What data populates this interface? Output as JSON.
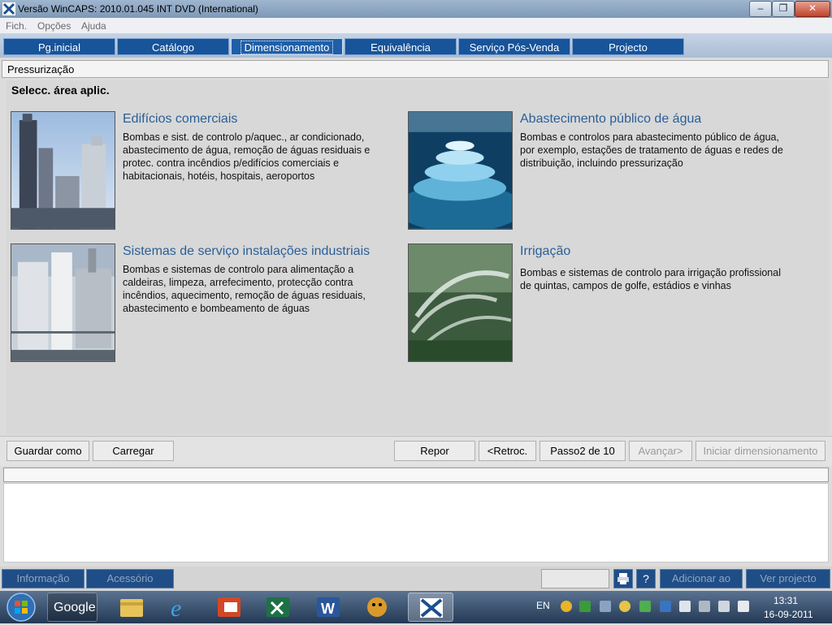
{
  "window": {
    "title": "Versão WinCAPS: 2010.01.045 INT DVD (International)",
    "minimize_glyph": "–",
    "maximize_glyph": "❐",
    "close_glyph": "✕"
  },
  "menu": {
    "items": [
      "Fich.",
      "Opções",
      "Ajuda"
    ]
  },
  "nav": {
    "tabs": [
      "Pg.inicial",
      "Catálogo",
      "Dimensionamento",
      "Equivalência",
      "Serviço Pós-Venda",
      "Projecto"
    ],
    "active_tab": "Dimensionamento"
  },
  "breadcrumb": "Pressurização",
  "main": {
    "heading": "Selecc. área aplic.",
    "cards": [
      {
        "title": "Edifícios comerciais",
        "desc": [
          "Bombas e sist. de controlo p/aquec., ar condicionado,",
          "abastecimento de água, remoção de águas residuais e",
          "protec. contra incêndios p/edifícios comerciais e",
          "habitacionais, hotéis, hospitais, aeroportos"
        ]
      },
      {
        "title": "Abastecimento público de água",
        "desc": [
          "Bombas e controlos para abastecimento público de água,",
          "por exemplo, estações de tratamento de águas e redes de",
          "distribuição, incluindo pressurização"
        ]
      },
      {
        "title": "Sistemas de serviço instalações industriais",
        "desc": [
          "Bombas e sistemas de controlo para alimentação a",
          "caldeiras, limpeza, arrefecimento, protecção contra",
          "incêndios, aquecimento, remoção de águas residuais,",
          "abastecimento e bombeamento de águas"
        ]
      },
      {
        "title": "Irrigação",
        "desc": [
          "Bombas e sistemas de controlo para irrigação profissional",
          "de quintas, campos de golfe, estádios e vinhas"
        ]
      }
    ]
  },
  "toolbar": {
    "save_as": "Guardar como",
    "load": "Carregar",
    "reset": "Repor",
    "back": "<Retroc.",
    "step": "Passo2 de 10",
    "next": "Avançar>",
    "start_sizing": "Iniciar dimensionamento"
  },
  "statusbar": {
    "info": "Informação",
    "accessories": "Acessório",
    "add_to": "Adicionar ao",
    "view_project": "Ver projecto",
    "help_glyph": "?"
  },
  "taskbar": {
    "google_label": "Google",
    "lang": "EN",
    "time": "13:31",
    "date": "16-09-2011"
  },
  "colors": {
    "nav_tab": "#17549a",
    "card_title": "#2a5f97",
    "status_button": "#1f4d86"
  }
}
